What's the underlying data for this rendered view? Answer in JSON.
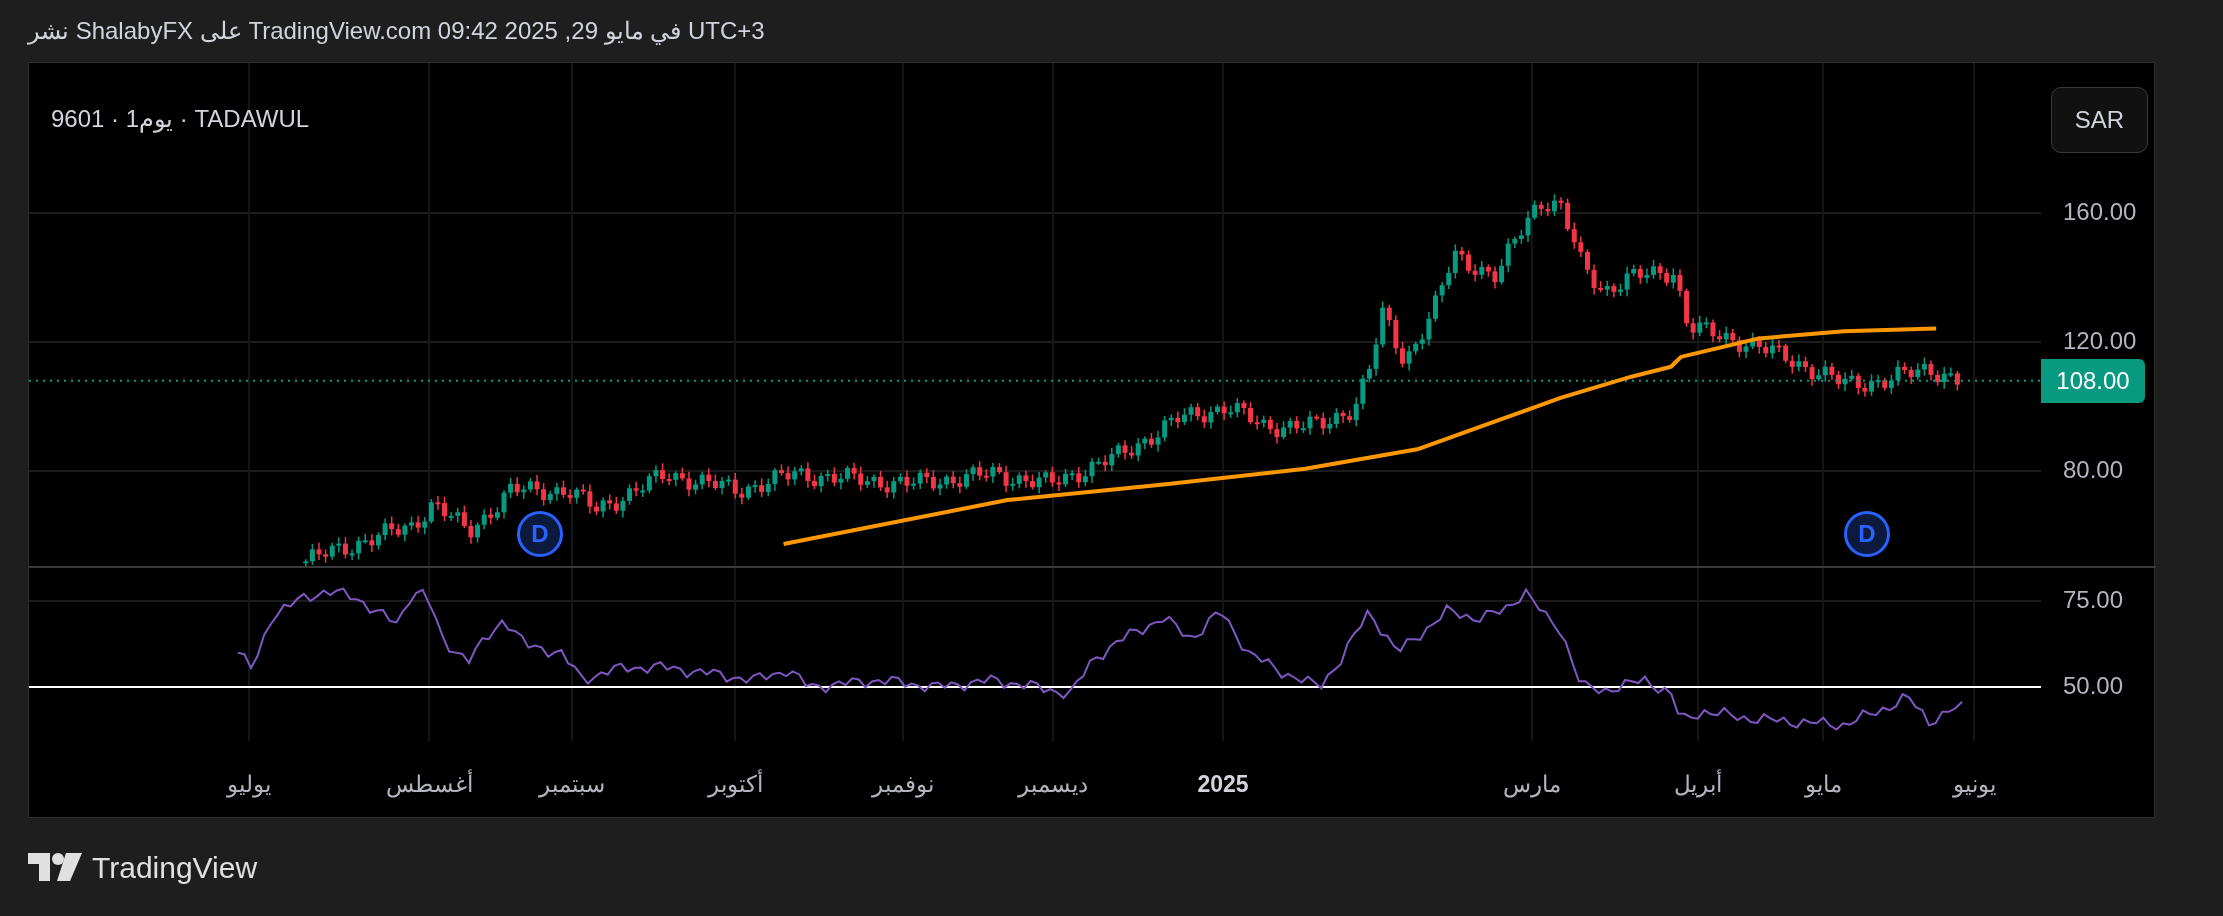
{
  "header": {
    "text": "نشر ShalabyFX على TradingView.com في مايو 29, 2025 09:42 UTC+3"
  },
  "chart": {
    "symbol_line": "9601 · يوم1 · TADAWUL",
    "currency_button": "SAR",
    "last_price": "108.00",
    "price_axis": [
      "160.00",
      "120.00",
      "80.00"
    ],
    "rsi_axis": [
      "75.00",
      "50.00"
    ],
    "time_axis": [
      {
        "label": "يونيو",
        "kind": "month"
      },
      {
        "label": "مايو",
        "kind": "month"
      },
      {
        "label": "أبريل",
        "kind": "month"
      },
      {
        "label": "مارس",
        "kind": "month"
      },
      {
        "label": "2025",
        "kind": "year"
      },
      {
        "label": "ديسمبر",
        "kind": "month"
      },
      {
        "label": "نوفمبر",
        "kind": "month"
      },
      {
        "label": "أكتوبر",
        "kind": "month"
      },
      {
        "label": "سبتمبر",
        "kind": "month"
      },
      {
        "label": "أغسطس",
        "kind": "month"
      },
      {
        "label": "يوليو",
        "kind": "month"
      }
    ],
    "event_markers": [
      {
        "label": "D"
      },
      {
        "label": "D"
      }
    ]
  },
  "footer": {
    "logo_text": "TradingView"
  }
}
